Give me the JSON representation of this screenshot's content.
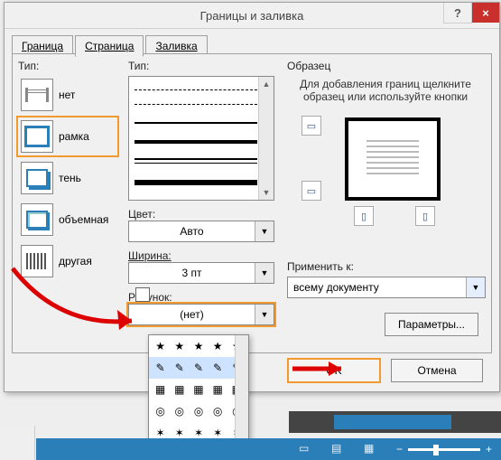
{
  "window": {
    "title": "Границы и заливка",
    "help": "?",
    "close": "×"
  },
  "tabs": {
    "border": "Граница",
    "page": "Страница",
    "fill": "Заливка"
  },
  "labels": {
    "tip": "Тип:",
    "tip2": "Тип:",
    "color": "Цвет:",
    "width": "Ширина:",
    "art": "Рисунок:",
    "sample": "Образец",
    "sample_hint": "Для добавления границ щелкните образец или используйте кнопки",
    "apply_to": "Применить к:",
    "params": "Параметры...",
    "ok": "OK",
    "cancel": "Отмена"
  },
  "tip_options": {
    "none": "нет",
    "box": "рамка",
    "shadow": "тень",
    "threeD": "объемная",
    "custom": "другая"
  },
  "color_value": "Авто",
  "width_value": "3 пт",
  "art_value": "(нет)",
  "apply_value": "всему документу",
  "art_glyphs": {
    "stars": "★",
    "pencils": "✎",
    "blocks": "▦",
    "medals": "◎",
    "pins": "✶"
  },
  "status": {
    "zoom_minus": "−",
    "zoom_plus": "+"
  }
}
